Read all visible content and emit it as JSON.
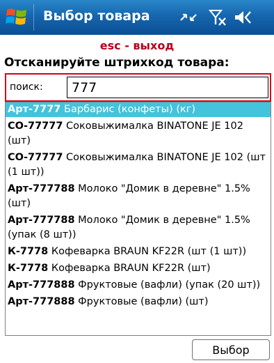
{
  "titlebar": {
    "title": "Выбор товара",
    "icons": [
      "windows-logo-icon",
      "connectivity-icon",
      "no-signal-icon",
      "volume-icon"
    ]
  },
  "header": {
    "exit_hint": "esc - выход",
    "prompt": "Отсканируйте штрихкод товара:"
  },
  "search": {
    "label": "поиск:",
    "value": "777"
  },
  "items": [
    {
      "code": "Арт-7777",
      "name": " Барбарис (конфеты) (кг)",
      "selected": true
    },
    {
      "code": "СО-77777",
      "name": " Соковыжималка  BINATONE JE 102 (шт)"
    },
    {
      "code": "СО-77777",
      "name": " Соковыжималка  BINATONE JE 102 (шт (1 шт))"
    },
    {
      "code": "Арт-777788",
      "name": " Молоко \"Домик в деревне\" 1.5% (шт)"
    },
    {
      "code": "Арт-777788",
      "name": " Молоко \"Домик в деревне\" 1.5% (упак (8 шт))"
    },
    {
      "code": "К-7778",
      "name": " Кофеварка BRAUN KF22R (шт (1 шт))"
    },
    {
      "code": "К-7778",
      "name": " Кофеварка BRAUN KF22R (шт)"
    },
    {
      "code": "Арт-777888",
      "name": " Фруктовые (вафли) (упак (20 шт))"
    },
    {
      "code": "Арт-777888",
      "name": " Фруктовые (вафли) (шт)"
    }
  ],
  "footer": {
    "select_label": "Выбор"
  },
  "colors": {
    "title_bar": "#1666ae",
    "selection": "#43c3dc",
    "exit_hint": "#b5001b",
    "search_border": "#d0021b"
  }
}
